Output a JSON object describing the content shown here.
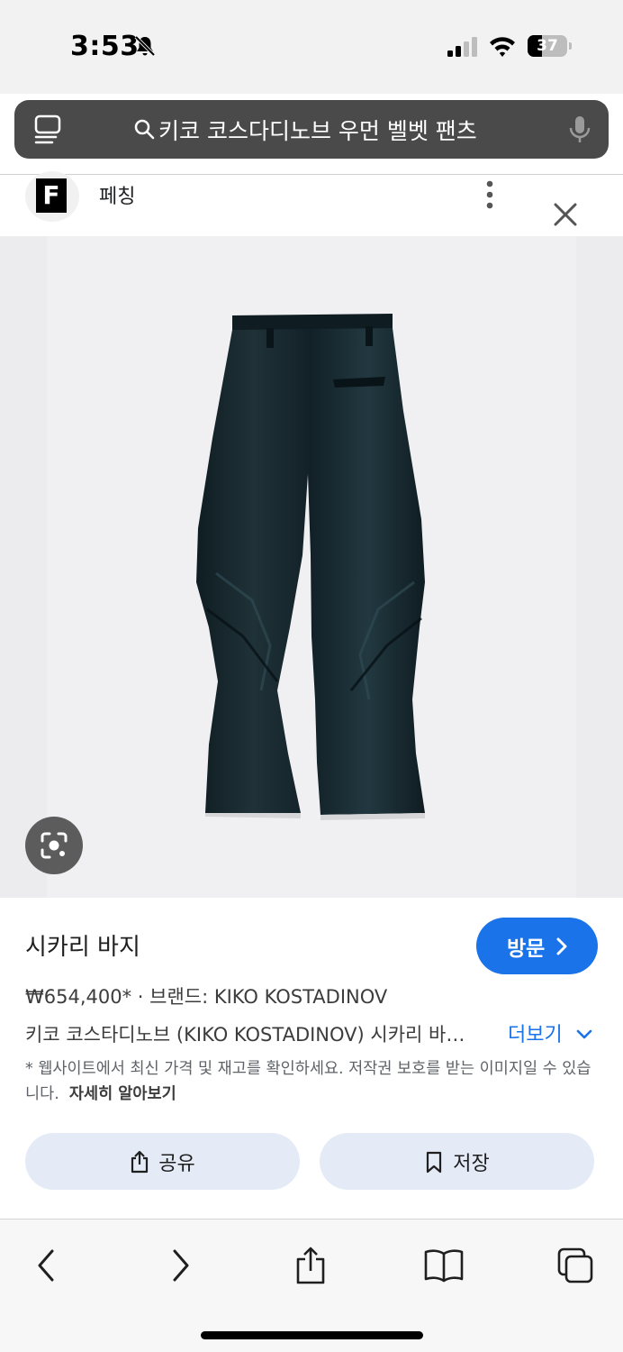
{
  "status_bar": {
    "time": "3:53",
    "battery_level": "37",
    "battery_fraction": 0.37,
    "icons": [
      "bell-slash-icon",
      "signal-icon",
      "wifi-icon",
      "battery-icon"
    ]
  },
  "search": {
    "query": "키코 코스다디노브 우먼 벨벳 팬츠",
    "icons": [
      "tabs-icon",
      "search-icon",
      "mic-icon"
    ]
  },
  "source": {
    "logo_letter": "F",
    "name": "페칭"
  },
  "product": {
    "title": "시카리 바지",
    "visit_label": "방문",
    "price_line": "₩654,400* · 브랜드: KIKO KOSTADINOV",
    "description": "키코 코스타디노브 (KIKO KOSTADINOV) 시카리 바…",
    "more_label": "더보기",
    "notice_text": "* 웹사이트에서 최신 가격 및 재고를 확인하세요. 저작권 보호를 받는 이미지일 수 있습니다.",
    "notice_link": "자세히 알아보기",
    "share_label": "공유",
    "save_label": "저장"
  },
  "colors": {
    "accent": "#1a73e8",
    "search_bar": "#4a4a4a",
    "action_button": "#e4ebf7",
    "product": "#16262b"
  },
  "toolbar": {
    "icons": [
      "back-icon",
      "forward-icon",
      "share-icon",
      "bookmarks-icon",
      "tabs-icon"
    ]
  }
}
